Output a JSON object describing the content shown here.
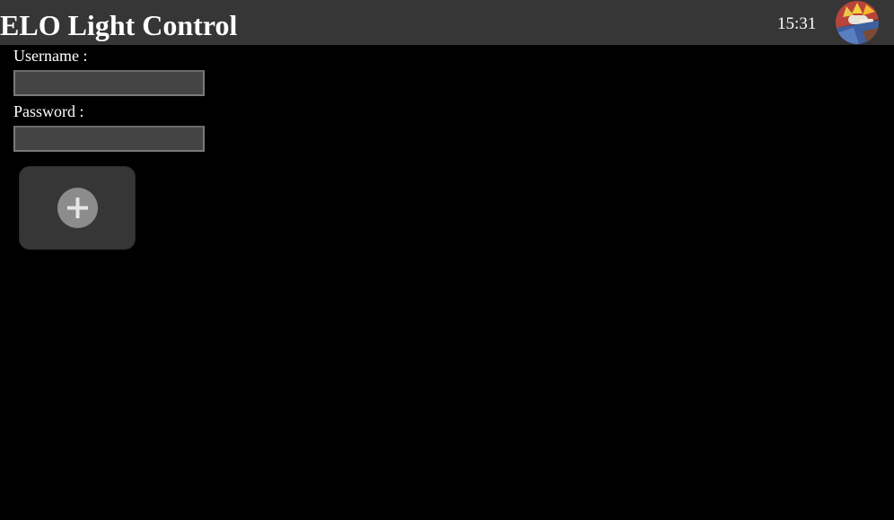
{
  "header": {
    "title": "ELO Light Control",
    "time": "15:31",
    "background_color": "#363636",
    "avatar_icon": "user-avatar-icon"
  },
  "login": {
    "username_label": "Username :",
    "username_value": "",
    "password_label": "Password :",
    "password_value": ""
  },
  "tiles": {
    "add_icon": "plus-circle-icon"
  },
  "colors": {
    "page_background": "#000000",
    "tile_background": "#363636",
    "input_background": "#444444"
  }
}
